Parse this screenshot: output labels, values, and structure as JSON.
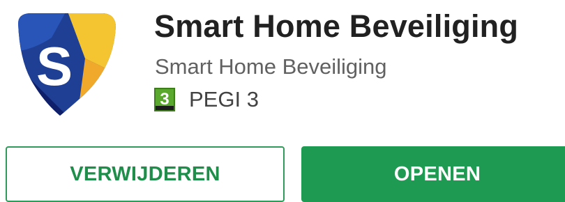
{
  "app": {
    "title": "Smart Home Beveiliging",
    "developer": "Smart Home Beveiliging",
    "icon": "shield-s-logo-icon",
    "icon_letter": "S",
    "icon_colors": {
      "blue": "#1f3f94",
      "yellow": "#f5c431",
      "white": "#ffffff"
    }
  },
  "rating": {
    "badge_number": "3",
    "label": "PEGI 3",
    "badge_color": "#5aa92e"
  },
  "actions": {
    "uninstall_label": "VERWIJDEREN",
    "open_label": "OPENEN",
    "accent_color": "#1f9a52"
  }
}
